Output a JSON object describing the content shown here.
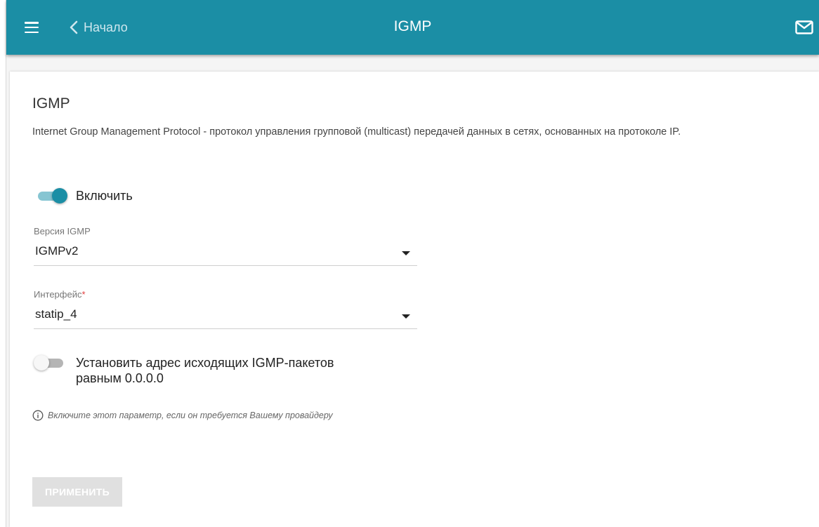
{
  "header": {
    "title": "IGMP",
    "back_label": "Начало",
    "icons": [
      "menu-icon",
      "chevron-left-icon",
      "mail-icon"
    ]
  },
  "section": {
    "title": "IGMP",
    "description": "Internet Group Management Protocol - протокол управления групповой (multicast) передачей данных в сетях, основанных на протоколе IP."
  },
  "enable": {
    "label": "Включить",
    "state": "on"
  },
  "igmp_version": {
    "label": "Версия IGMP",
    "value": "IGMPv2"
  },
  "interface": {
    "label": "Интерфейс",
    "required_mark": "*",
    "value": "statip_4"
  },
  "source_address": {
    "label_line1": "Установить адрес исходящих IGMP-пакетов",
    "label_line2": "равным 0.0.0.0",
    "state": "off"
  },
  "hint": {
    "icon": "info-icon",
    "text": "Включите этот параметр, если он требуется Вашему провайдеру"
  },
  "apply_button": {
    "label": "ПРИМЕНИТЬ",
    "disabled": true
  },
  "colors": {
    "accent": "#1b8ea5",
    "toggle_track_on": "#86c5d2",
    "required": "#e03c3c",
    "button_disabled": "#e0e0e0"
  }
}
